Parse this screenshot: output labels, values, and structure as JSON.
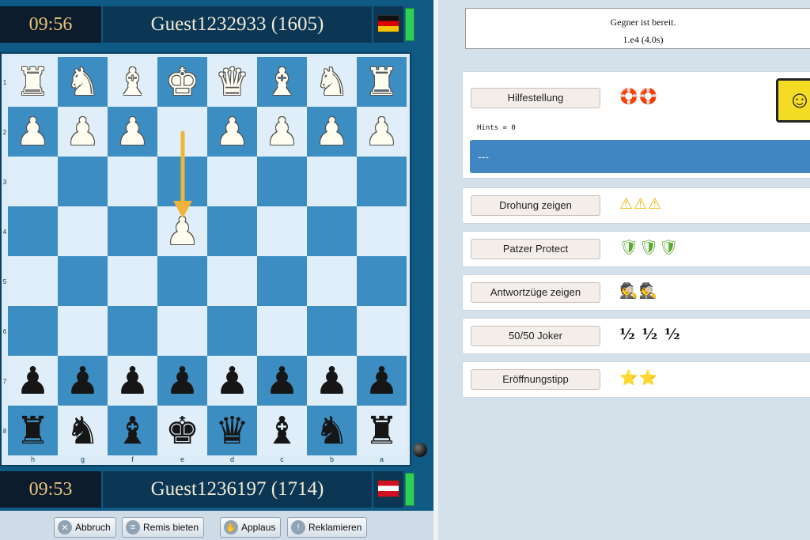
{
  "opponent": {
    "clock": "09:56",
    "name": "Guest1232933 (1605)"
  },
  "me": {
    "clock": "09:53",
    "name": "Guest1236197 (1714)"
  },
  "board": {
    "rows": [
      {
        "rank": "1",
        "squares": [
          "♜",
          "♞",
          "♝",
          "♚",
          "♛",
          "♝",
          "♞",
          "♜"
        ],
        "colors": [
          "w",
          "w",
          "w",
          "w",
          "w",
          "w",
          "w",
          "w"
        ]
      },
      {
        "rank": "2",
        "squares": [
          "♟",
          "♟",
          "♟",
          "",
          "♟",
          "♟",
          "♟",
          "♟"
        ],
        "colors": [
          "w",
          "w",
          "w",
          "",
          "w",
          "w",
          "w",
          "w"
        ]
      },
      {
        "rank": "3",
        "squares": [
          "",
          "",
          "",
          "",
          "",
          "",
          "",
          ""
        ],
        "colors": [
          "",
          "",
          "",
          "",
          "",
          "",
          "",
          ""
        ]
      },
      {
        "rank": "4",
        "squares": [
          "",
          "",
          "",
          "♟",
          "",
          "",
          "",
          ""
        ],
        "colors": [
          "",
          "",
          "",
          "w",
          "",
          "",
          "",
          ""
        ]
      },
      {
        "rank": "5",
        "squares": [
          "",
          "",
          "",
          "",
          "",
          "",
          "",
          ""
        ],
        "colors": [
          "",
          "",
          "",
          "",
          "",
          "",
          "",
          ""
        ]
      },
      {
        "rank": "6",
        "squares": [
          "",
          "",
          "",
          "",
          "",
          "",
          "",
          ""
        ],
        "colors": [
          "",
          "",
          "",
          "",
          "",
          "",
          "",
          ""
        ]
      },
      {
        "rank": "7",
        "squares": [
          "♟",
          "♟",
          "♟",
          "♟",
          "♟",
          "♟",
          "♟",
          "♟"
        ],
        "colors": [
          "b",
          "b",
          "b",
          "b",
          "b",
          "b",
          "b",
          "b"
        ]
      },
      {
        "rank": "8",
        "squares": [
          "♜",
          "♞",
          "♝",
          "♚",
          "♛",
          "♝",
          "♞",
          "♜"
        ],
        "colors": [
          "b",
          "b",
          "b",
          "b",
          "b",
          "b",
          "b",
          "b"
        ]
      }
    ],
    "files": [
      "h",
      "g",
      "f",
      "e",
      "d",
      "c",
      "b",
      "a"
    ],
    "last_move": {
      "from": "e2",
      "to": "e4"
    }
  },
  "buttons": {
    "abort": "Abbruch",
    "draw": "Remis bieten",
    "applause": "Applaus",
    "claim": "Reklamieren"
  },
  "status": {
    "line1": "Gegner ist bereit.",
    "line2": "1.e4  (4.0s)"
  },
  "help": {
    "hint_label": "Hilfestellung",
    "hint_icons": "🛟🛟",
    "hints_count": "Hints = 0",
    "hint_text": "---",
    "threat_label": "Drohung zeigen",
    "threat_icons": "⚠⚠⚠",
    "patzer_label": "Patzer Protect",
    "patzer_icons": "🛡🛡🛡",
    "reply_label": "Antwortzüge zeigen",
    "reply_icons": "🕵🕵",
    "joker_label": "50/50 Joker",
    "joker_icons": "½ ½ ½",
    "opening_label": "Eröffnungstipp",
    "opening_icons": "⭐⭐"
  },
  "colors": {
    "light_square": "#dfeef8",
    "dark_square": "#3c8dc2",
    "accent": "#3f86c2",
    "arrow": "#f0b43a"
  }
}
